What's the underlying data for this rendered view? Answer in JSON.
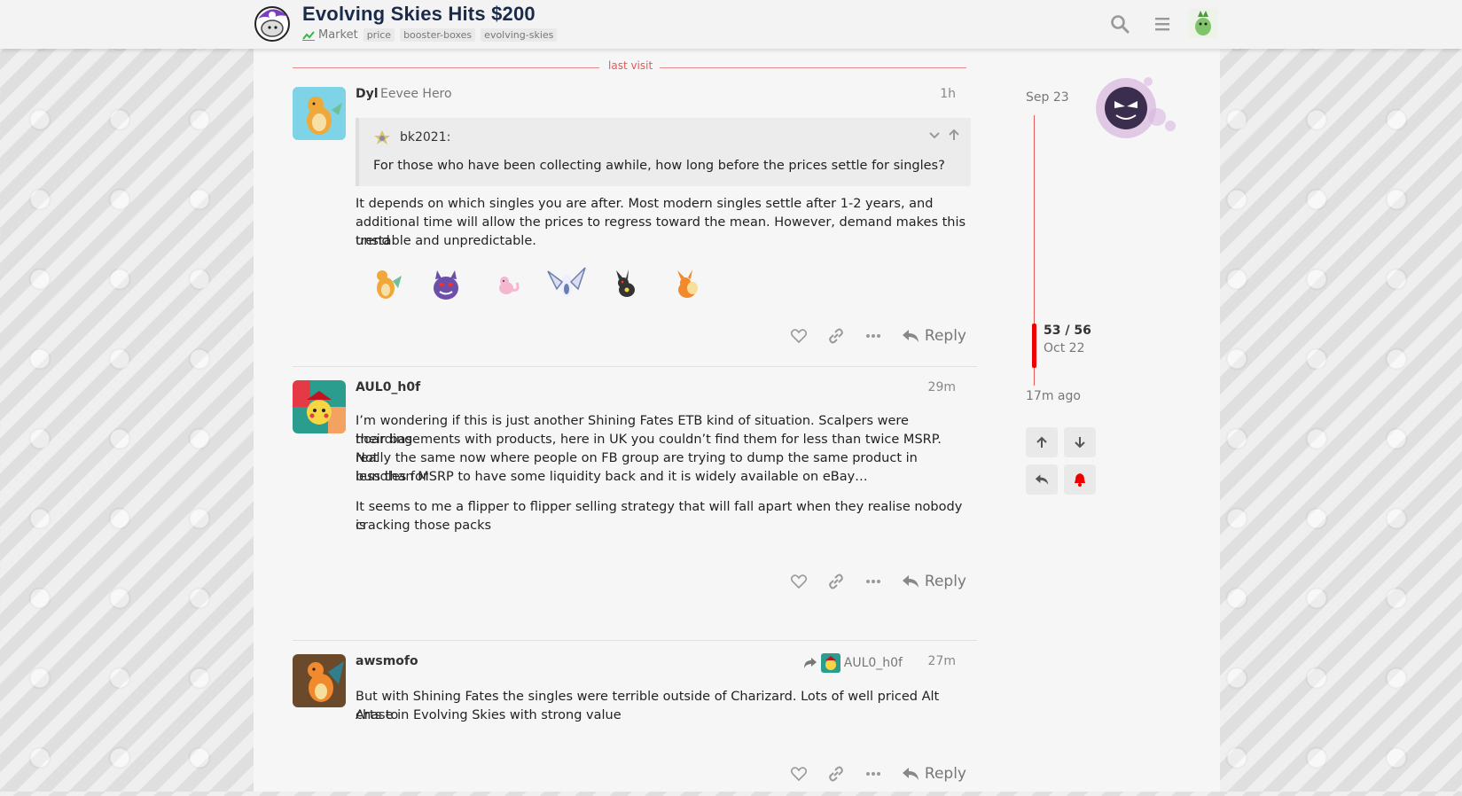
{
  "header": {
    "title": "Evolving Skies Hits $200",
    "category": "Market",
    "tags": [
      "price",
      "booster-boxes",
      "evolving-skies"
    ],
    "icons": [
      "search-icon",
      "hamburger-menu-icon"
    ]
  },
  "last_visit_label": "last visit",
  "posts": [
    {
      "username": "Dyl",
      "user_title": "Eevee Hero",
      "time": "1h",
      "quote": {
        "author": "bk2021:",
        "text": "For those who have been collecting awhile, how long before the prices settle for singles?"
      },
      "paragraphs": [
        "It depends on which singles you are after. Most modern singles settle after 1-2 years, and",
        "additional time will allow the prices to regress toward the mean. However, demand makes this trend",
        "unstable and unpredictable."
      ],
      "emojis": [
        "dragonite",
        "gengar",
        "mew",
        "lugia",
        "umbreon",
        "flareon"
      ],
      "reply_label": "Reply"
    },
    {
      "username": "AUL0_h0f",
      "time": "29m",
      "paragraphs": [
        "I’m wondering if this is just another Shining Fates ETB kind of situation. Scalpers were hoarding",
        "their basements with products, here in UK you couldn’t find them for less than twice MSRP. Not",
        "really the same now where people on FB group are trying to dump the same product in bundles for",
        "less than MSRP to have some liquidity back and it is widely available on eBay…"
      ],
      "paragraphs2": [
        "It seems to me a flipper to flipper selling strategy that will fall apart when they realise nobody is",
        "cracking those packs"
      ],
      "reply_label": "Reply"
    },
    {
      "username": "awsmofo",
      "time": "27m",
      "reply_to": "AUL0_h0f",
      "paragraphs": [
        "But with Shining Fates the singles were terrible outside of Charizard. Lots of well priced Alt Arts to",
        "chase in Evolving Skies with strong value"
      ],
      "reply_label": "Reply"
    }
  ],
  "timeline": {
    "start_date": "Sep 23",
    "position": "53 / 56",
    "position_date": "Oct 22",
    "end_label": "17m ago"
  },
  "colors": {
    "accent_red": "#e45958",
    "title_navy": "#1b2a4a",
    "market_green": "#3ab54a"
  }
}
